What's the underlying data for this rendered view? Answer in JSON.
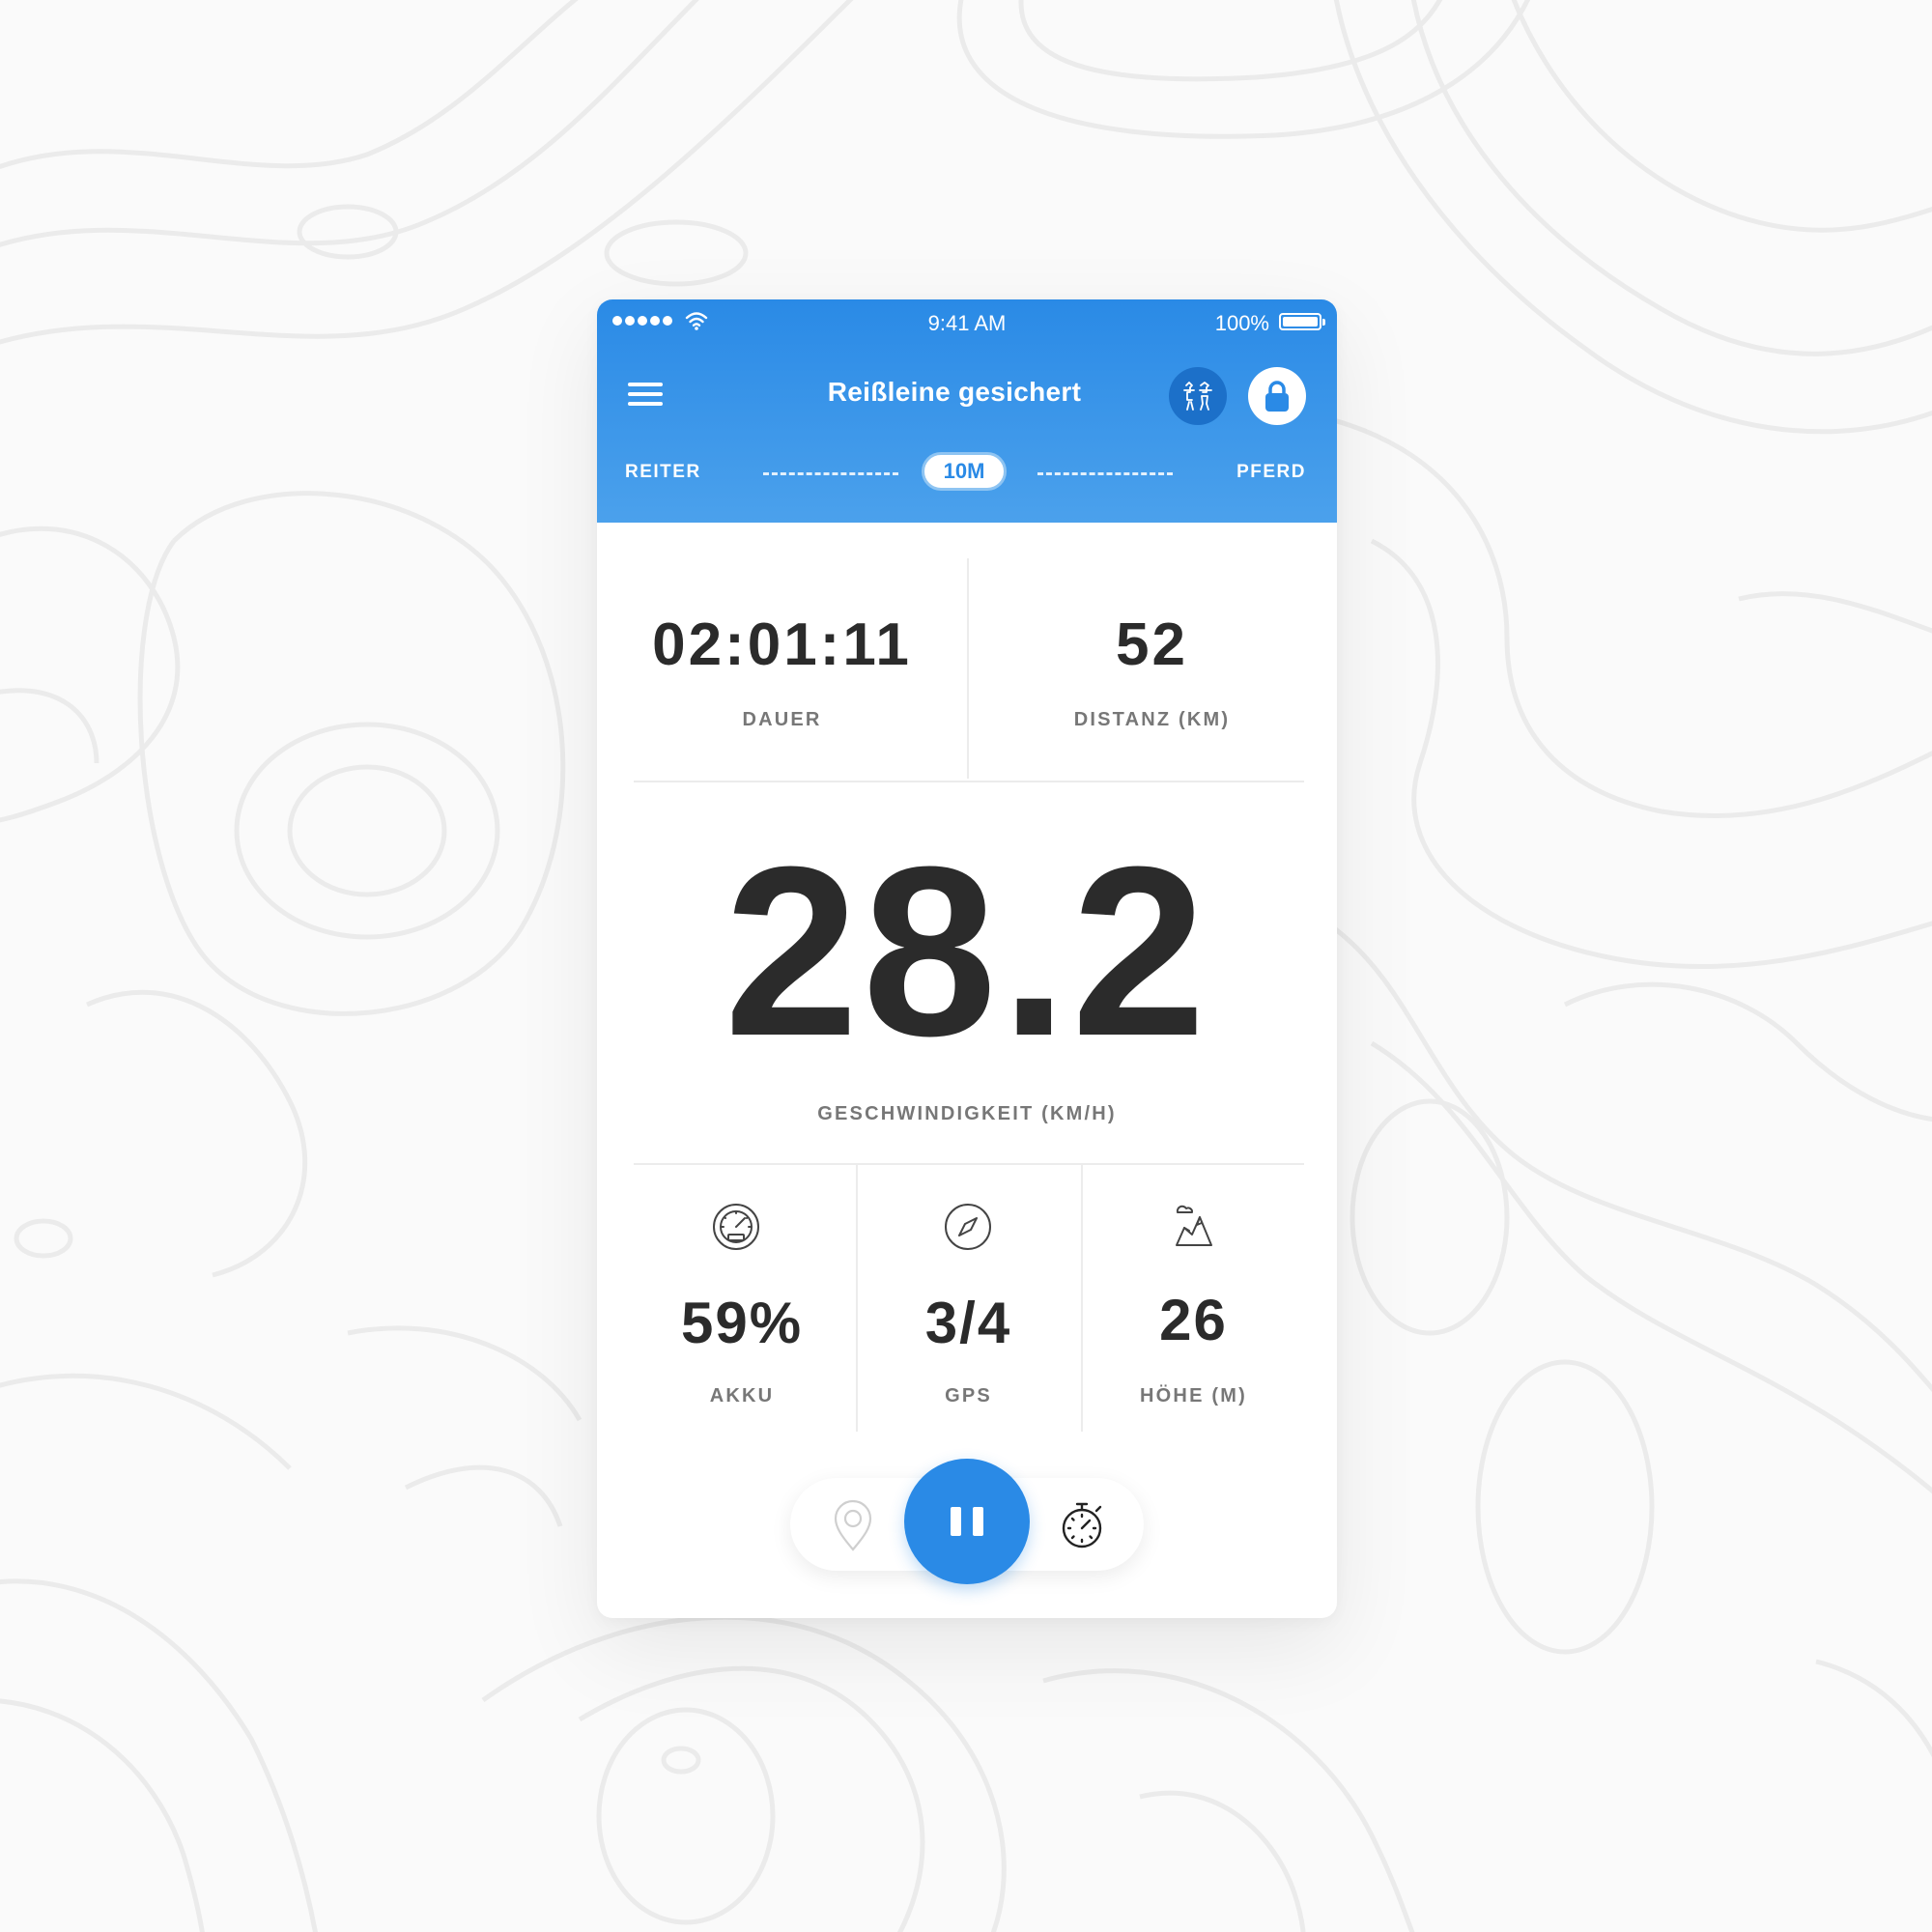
{
  "status_bar": {
    "time": "9:41 AM",
    "battery": "100%"
  },
  "header": {
    "title": "Reißleine gesichert",
    "tether": {
      "left": "REITER",
      "distance": "10M",
      "right": "PFERD"
    }
  },
  "stats": {
    "duration": {
      "value": "02:01:11",
      "label": "DAUER"
    },
    "distance": {
      "value": "52",
      "label": "DISTANZ (KM)"
    },
    "speed": {
      "value": "28.2",
      "label": "GESCHWINDIGKEIT (KM/H)"
    },
    "battery": {
      "value": "59%",
      "label": "AKKU",
      "icon": "gauge-icon"
    },
    "gps": {
      "value": "3/4",
      "label": "GPS",
      "icon": "compass-icon"
    },
    "altitude": {
      "value": "26",
      "label": "HÖHE (M)",
      "icon": "mountain-icon"
    }
  },
  "controls": {
    "left_icon": "location-pin-icon",
    "center_icon": "pause-icon",
    "right_icon": "stopwatch-icon"
  },
  "colors": {
    "accent": "#2a8ae6",
    "accent_dark": "#1c70c9",
    "text": "#2b2b2b",
    "label": "#777777",
    "background": "#fafafa"
  }
}
